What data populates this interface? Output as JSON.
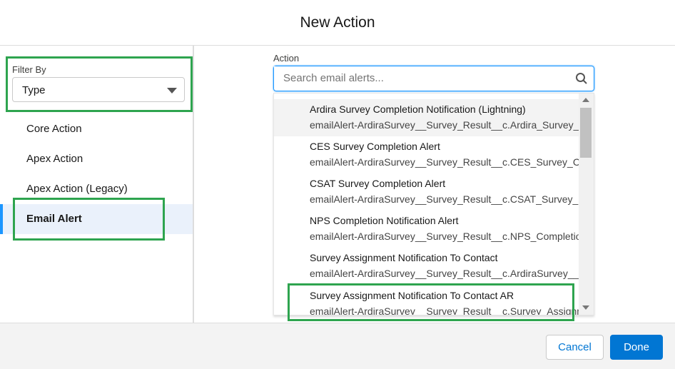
{
  "title": "New Action",
  "filter": {
    "label": "Filter By",
    "value": "Type"
  },
  "nav": [
    "Core Action",
    "Apex Action",
    "Apex Action (Legacy)",
    "Email Alert"
  ],
  "action": {
    "label": "Action",
    "placeholder": "Search email alerts..."
  },
  "options": [
    {
      "title": "Ardira Survey Completion Notification (Lightning)",
      "sub": "emailAlert-ArdiraSurvey__Survey_Result__c.Ardira_Survey_C..."
    },
    {
      "title": "CES Survey Completion Alert",
      "sub": "emailAlert-ArdiraSurvey__Survey_Result__c.CES_Survey_Co..."
    },
    {
      "title": "CSAT Survey Completion Alert",
      "sub": "emailAlert-ArdiraSurvey__Survey_Result__c.CSAT_Survey_Co..."
    },
    {
      "title": "NPS Completion Notification Alert",
      "sub": "emailAlert-ArdiraSurvey__Survey_Result__c.NPS_Completio..."
    },
    {
      "title": "Survey Assignment Notification To Contact",
      "sub": "emailAlert-ArdiraSurvey__Survey_Result__c.ArdiraSurvey__S..."
    },
    {
      "title": "Survey Assignment Notification To Contact AR",
      "sub": "emailAlert-ArdiraSurvey__Survey_Result__c.Survey_Assignm..."
    }
  ],
  "footer": {
    "cancel": "Cancel",
    "done": "Done"
  }
}
